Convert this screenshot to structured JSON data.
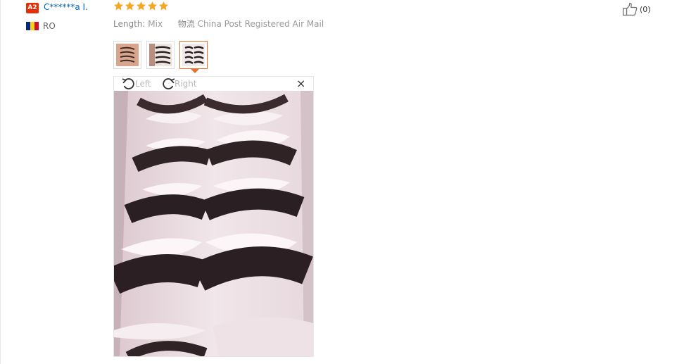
{
  "reviewer": {
    "level_badge": "A2",
    "name": "C******a I.",
    "country_code": "RO",
    "flag_colors": [
      "#002b7f",
      "#fcd116",
      "#ce1126"
    ]
  },
  "review": {
    "rating": 5,
    "rating_max": 5,
    "star_color": "#f5a623",
    "attributes": {
      "length_key": "Length:",
      "length_value": "Mix",
      "logistics_key": "物流",
      "logistics_value": "China Post Registered Air Mail"
    },
    "like_count": "(0)"
  },
  "gallery": {
    "selected_index": 2,
    "accent_color": "#e5732e",
    "thumbnails": [
      {
        "name": "photo-1"
      },
      {
        "name": "photo-2"
      },
      {
        "name": "photo-3"
      }
    ],
    "viewer": {
      "rotate_left_label": "Left",
      "rotate_right_label": "Right",
      "close_symbol": "×"
    }
  }
}
